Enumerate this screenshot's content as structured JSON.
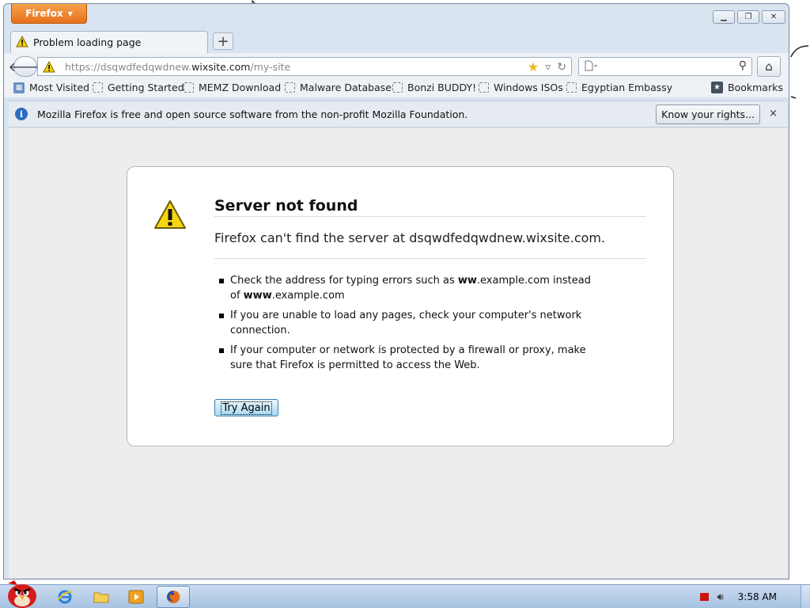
{
  "window": {
    "app_button": "Firefox",
    "controls": {
      "minimize": "▭",
      "restore": "❐",
      "close": "✕"
    }
  },
  "tab": {
    "title": "Problem loading page",
    "new_tab": "+"
  },
  "nav": {
    "url_prefix": "https://dsqwdfedqwdnew.",
    "url_domain": "wixsite.com",
    "url_suffix": "/my-site",
    "search_placeholder": ""
  },
  "bookmarks": {
    "items": [
      {
        "label": "Most Visited",
        "icon": "most-visited-icon"
      },
      {
        "label": "Getting Started",
        "icon": "folder-icon"
      },
      {
        "label": "MEMZ Download",
        "icon": "folder-icon"
      },
      {
        "label": "Malware Database",
        "icon": "folder-icon"
      },
      {
        "label": "Bonzi BUDDY!",
        "icon": "folder-icon"
      },
      {
        "label": "Windows ISOs",
        "icon": "folder-icon"
      },
      {
        "label": "Egyptian Embassy",
        "icon": "folder-icon"
      }
    ],
    "bookmarks_menu": "Bookmarks"
  },
  "notification": {
    "message": "Mozilla Firefox is free and open source software from the non-profit Mozilla Foundation.",
    "button": "Know your rights...",
    "close": "×"
  },
  "error": {
    "title": "Server not found",
    "short_desc": "Firefox can't find the server at dsqwdfedqwdnew.wixsite.com.",
    "item1_a": "Check the address for typing errors such as ",
    "item1_b": "ww",
    "item1_c": ".example.com instead of ",
    "item1_d": "www",
    "item1_e": ".example.com",
    "item2": "If you are unable to load any pages, check your computer's network connection.",
    "item3": "If your computer or network is protected by a firewall or proxy, make sure that Firefox is permitted to access the Web.",
    "try_again": "Try Again"
  },
  "taskbar": {
    "time": "3:58 AM"
  },
  "colors": {
    "firefox_orange": "#e7711b",
    "info_blue": "#2f6cc0",
    "warning_yellow": "#f5d100"
  }
}
